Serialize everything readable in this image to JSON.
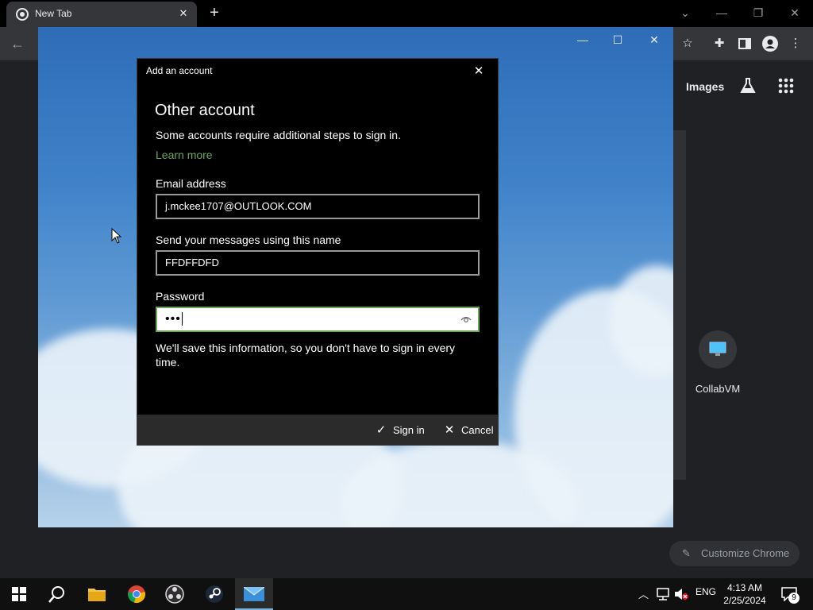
{
  "chrome": {
    "tab_title": "New Tab",
    "tab_close": "✕",
    "new_tab": "+",
    "images_link": "Images",
    "shortcut_label": "CollabVM",
    "customize_label": "Customize Chrome"
  },
  "mail_window": {
    "minimize": "—",
    "maximize": "☐",
    "close": "✕"
  },
  "dialog": {
    "title": "Add an account",
    "heading": "Other account",
    "subtext": "Some accounts require additional steps to sign in.",
    "learn_more": "Learn more",
    "email_label": "Email address",
    "email_value": "j.mckee1707@OUTLOOK.COM",
    "name_label": "Send your messages using this name",
    "name_value": "FFDFFDFD",
    "password_label": "Password",
    "password_value": "•••",
    "note": "We'll save this information, so you don't have to sign in every time.",
    "sign_in": "Sign in",
    "cancel": "Cancel"
  },
  "taskbar": {
    "language": "ENG",
    "time": "4:13 AM",
    "date": "2/25/2024",
    "notification_count": "9"
  },
  "colors": {
    "accent_green": "#6aa55b",
    "dialog_bg": "#000000",
    "footer_bg": "#2b2b2b"
  }
}
